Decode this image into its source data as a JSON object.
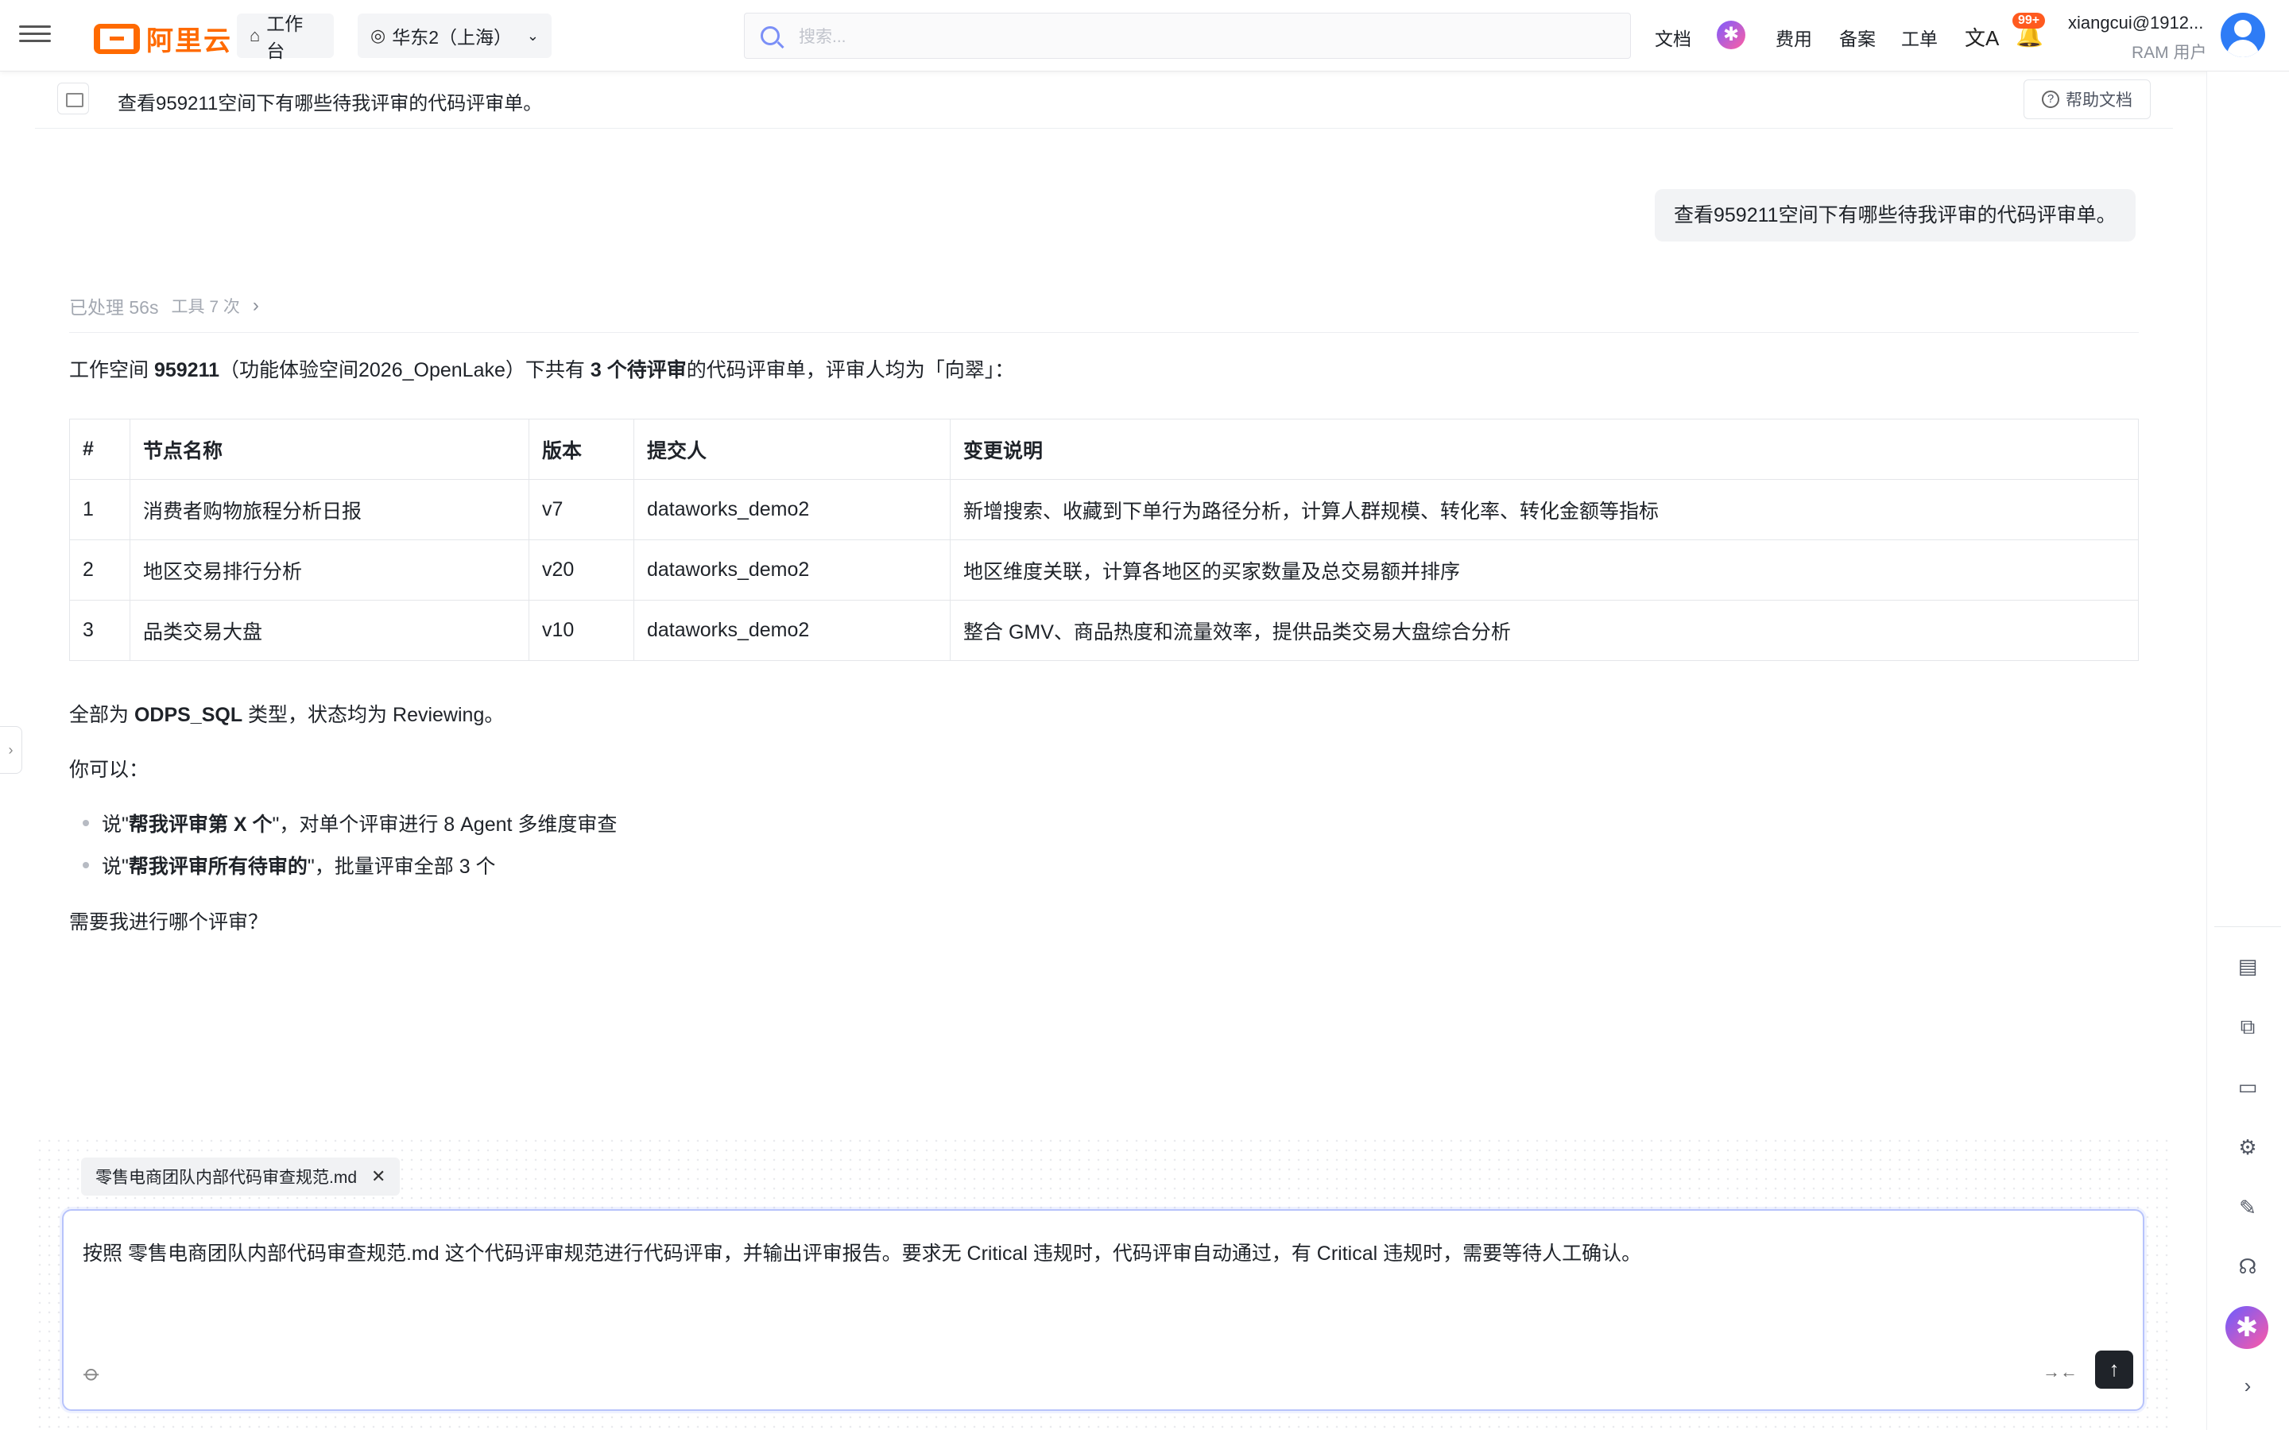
{
  "topbar": {
    "logo_text": "阿里云",
    "workbench_label": "工作台",
    "region_label": "华东2（上海）",
    "search_placeholder": "搜索...",
    "links": [
      "文档",
      "费用",
      "备案",
      "工单"
    ],
    "notification_badge": "99+",
    "user_name": "xiangcui@1912...",
    "user_role": "RAM 用户",
    "accent_color": "#ff6a00"
  },
  "subheader": {
    "title": "查看959211空间下有哪些待我评审的代码评审单。",
    "help_label": "帮助文档"
  },
  "chat": {
    "user_message": "查看959211空间下有哪些待我评审的代码评审单。",
    "processed_label": "已处理 56s",
    "tools_label": "工具 7 次",
    "intro_prefix": "工作空间 ",
    "intro_id": "959211",
    "intro_mid": "（功能体验空间2026_OpenLake）下共有 ",
    "intro_count": "3 个待评审",
    "intro_suffix": "的代码评审单，评审人均为「向翠」：",
    "table": {
      "headers": [
        "#",
        "节点名称",
        "版本",
        "提交人",
        "变更说明"
      ],
      "rows": [
        [
          "1",
          "消费者购物旅程分析日报",
          "v7",
          "dataworks_demo2",
          "新增搜索、收藏到下单行为路径分析，计算人群规模、转化率、转化金额等指标"
        ],
        [
          "2",
          "地区交易排行分析",
          "v20",
          "dataworks_demo2",
          "地区维度关联，计算各地区的买家数量及总交易额并排序"
        ],
        [
          "3",
          "品类交易大盘",
          "v10",
          "dataworks_demo2",
          "整合 GMV、商品热度和流量效率，提供品类交易大盘综合分析"
        ]
      ]
    },
    "type_prefix": "全部为 ",
    "type_bold": "ODPS_SQL",
    "type_mid": " 类型，状态均为 ",
    "type_status": "Reviewing",
    "type_suffix": "。",
    "you_can": "你可以：",
    "bullet1_pre": "说\"",
    "bullet1_bold": "帮我评审第 X 个",
    "bullet1_post": "\"，对单个评审进行 8 Agent 多维度审查",
    "bullet2_pre": "说\"",
    "bullet2_bold": "帮我评审所有待审的",
    "bullet2_post": "\"，批量评审全部 3 个",
    "question": "需要我进行哪个评审？"
  },
  "composer": {
    "attachment_name": "零售电商团队内部代码审查规范.md",
    "input_text": "按照 零售电商团队内部代码审查规范.md 这个代码评审规范进行代码评审，并输出评审报告。要求无 Critical 违规时，代码评审自动通过，有 Critical 违规时，需要等待人工确认。"
  },
  "icons": {
    "rail": [
      "notes-icon",
      "ai-doc-icon",
      "terminal-icon",
      "settings-icon",
      "edit-icon",
      "support-icon",
      "ai-assistant-icon",
      "chevron-right-icon"
    ]
  }
}
